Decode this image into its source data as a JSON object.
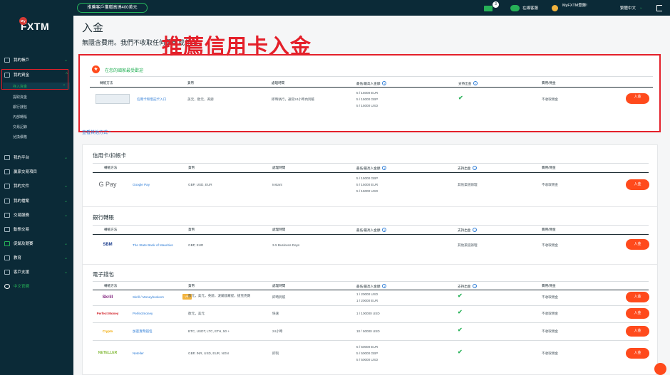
{
  "topbar": {
    "promo": "推薦客戶獲贈高達400美元",
    "msg_count": "3",
    "service": "在線客服",
    "user": "MyFXTM登錄!",
    "lang": "繁體中文"
  },
  "sidebar": {
    "logo_my": "My",
    "logo": "FXTM",
    "items": [
      {
        "label": "我的帳戶"
      },
      {
        "label": "我的資金"
      },
      {
        "label": "我的平台"
      },
      {
        "label": "贏家交易項目"
      },
      {
        "label": "我的文件"
      },
      {
        "label": "我的檔案"
      },
      {
        "label": "交易服務"
      },
      {
        "label": "動態交易"
      },
      {
        "label": "促銷及競賽"
      },
      {
        "label": "教育"
      },
      {
        "label": "客戶支援"
      },
      {
        "label": "中文官網"
      }
    ],
    "subs": [
      "存入資金",
      "提取資金",
      "銀行錢包",
      "內部轉賬",
      "交易記錄",
      "兌換價格"
    ]
  },
  "main": {
    "title": "入金",
    "subtitle": "無隱含費用。我們不收取任何費用或佣金。",
    "annotation": "推薦信用卡入金",
    "rec_header": "在您的國家最受歡迎",
    "other_link": "查看其他方式 ^",
    "cols": {
      "method": "轉帳方法",
      "currency": "貨幣",
      "time": "處理時間",
      "limits": "最低/最高入金額",
      "withdraw": "支持出金",
      "fees": "費用/佣金"
    },
    "deposit_btn": "入金",
    "rec_row": {
      "name": "信用卡和借記卡入口",
      "currency": "美元，歐元，英鎊",
      "time": "即時執行，通常24小時內到賬",
      "limits": [
        "5 / 15000 EUR",
        "5 / 15000 GBP",
        "5 / 15000 USD"
      ],
      "fees": "不收取佣金"
    },
    "sections": [
      {
        "title": "信用卡/扣帳卡",
        "rows": [
          {
            "logo": "G Pay",
            "name": "Google Pay",
            "currency": "GBP, USD, EUR",
            "time": "Instant",
            "limits": [
              "5 / 15000 GBP",
              "5 / 15000 EUR",
              "5 / 15000 USD"
            ],
            "withdraw": "其他渠道辦理",
            "fees": "不收取佣金"
          }
        ]
      },
      {
        "title": "銀行轉賬",
        "rows": [
          {
            "logo": "SBM",
            "name": "The State Bank of Mauritius",
            "currency": "GBP, EUR",
            "time": "3-5 Business Days",
            "limits": [],
            "withdraw": "其他渠道辦理",
            "fees": "不收取佣金"
          }
        ]
      },
      {
        "title": "電子錢包",
        "rows": [
          {
            "logo": "Skrill",
            "name": "Skrill / Moneybookers",
            "tag": "VIP",
            "currency": "歐元，美元，英鎊，波蘭茲羅提，捷克克朗",
            "time": "即時到賬",
            "limits": [
              "1 / 20000 USD",
              "1 / 20000 EUR"
            ],
            "fees": "不收取佣金"
          },
          {
            "logo": "Perfect Money",
            "name": "Perfectmoney",
            "currency": "歐元，美元",
            "time": "快速",
            "limits": [
              "1 / 100000 USD"
            ],
            "fees": "不收取佣金"
          },
          {
            "logo": "Crypto",
            "name": "加密貨幣錢包",
            "currency": "BTC, USDT, LTC, ETH, 50 +",
            "time": "24小時",
            "limits": [
              "10 / 50000 USD"
            ],
            "fees": "不收取佣金"
          },
          {
            "logo": "NETELLER",
            "name": "Neteller",
            "currency": "GBP, INR, USD, EUR, NGN",
            "time": "即刻",
            "limits": [
              "5 / 50000 EUR",
              "5 / 50000 GBP",
              "5 / 50000 USD"
            ],
            "fees": "不收取佣金"
          }
        ]
      }
    ]
  },
  "colors": {
    "accent": "#ff4a1c",
    "brand": "#0b2a37",
    "highlight": "#e4202a",
    "green": "#26b157"
  }
}
